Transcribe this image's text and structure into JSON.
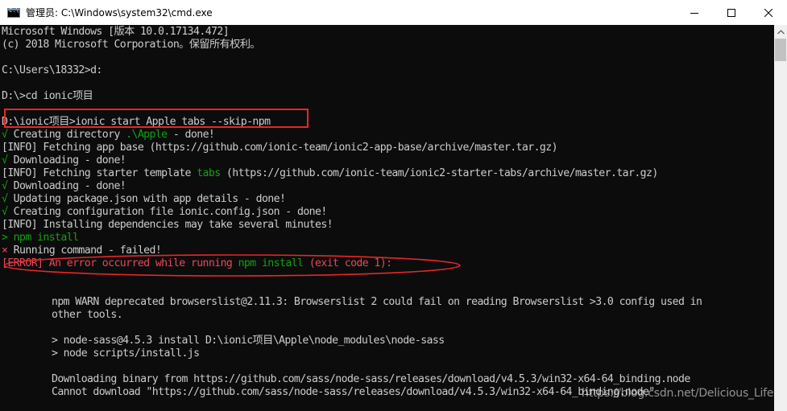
{
  "window": {
    "title": "管理员: C:\\Windows\\system32\\cmd.exe"
  },
  "colors": {
    "console_bg": "#0c0c0c",
    "text": "#cccccc",
    "green": "#13a10e",
    "red": "#e74856",
    "annotation": "#e8262a"
  },
  "console": {
    "l01": "Microsoft Windows [版本 10.0.17134.472]",
    "l02": "(c) 2018 Microsoft Corporation。保留所有权利。",
    "l03": "C:\\Users\\18332>d:",
    "l04": "D:\\>cd ionic项目",
    "l05": "D:\\ionic项目>ionic start Apple tabs --skip-npm",
    "l06": {
      "mark": "√",
      "a": " Creating directory ",
      "b": ".\\Apple",
      "c": " - done!"
    },
    "l07": {
      "tag": "[INFO]",
      "rest": " Fetching app base (https://github.com/ionic-team/ionic2-app-base/archive/master.tar.gz)"
    },
    "l08": {
      "mark": "√",
      "rest": " Downloading - done!"
    },
    "l09": {
      "tag": "[INFO]",
      "a": " Fetching starter template ",
      "b": "tabs",
      "c": " (https://github.com/ionic-team/ionic2-starter-tabs/archive/master.tar.gz)"
    },
    "l10": {
      "mark": "√",
      "rest": " Downloading - done!"
    },
    "l11": {
      "mark": "√",
      "rest": " Updating package.json with app details - done!"
    },
    "l12": {
      "mark": "√",
      "rest": " Creating configuration file ionic.config.json - done!"
    },
    "l13": {
      "tag": "[INFO]",
      "rest": " Installing dependencies may take several minutes!"
    },
    "l14": {
      "mark": ">",
      "rest": " npm install"
    },
    "l15": {
      "mark": "×",
      "rest": " Running command - failed!"
    },
    "l16": {
      "tag": "[ERROR]",
      "a": " An error occurred while running ",
      "b": "npm install",
      "c": " (exit code 1):"
    },
    "l17": "npm WARN deprecated browserslist@2.11.3: Browserslist 2 could fail on reading Browserslist >3.0 config used in",
    "l18": "other tools.",
    "l19": "> node-sass@4.5.3 install D:\\ionic项目\\Apple\\node_modules\\node-sass",
    "l20": "> node scripts/install.js",
    "l21": "Downloading binary from https://github.com/sass/node-sass/releases/download/v4.5.3/win32-x64-64_binding.node",
    "l22": "Cannot download \"https://github.com/sass/node-sass/releases/download/v4.5.3/win32-x64-64_binding.node\""
  },
  "watermark": "https://blog.csdn.net/Delicious_Life"
}
